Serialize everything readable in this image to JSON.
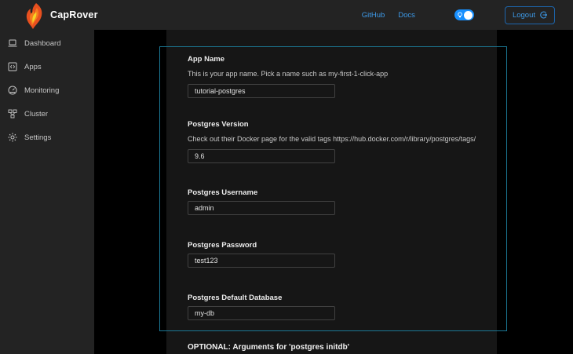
{
  "header": {
    "app_title": "CapRover",
    "logo_icon": "flame-logo-icon",
    "links": [
      {
        "label": "GitHub"
      },
      {
        "label": "Docs"
      }
    ],
    "theme_toggle": {
      "icon": "bulb-icon",
      "state": "on"
    },
    "logout_label": "Logout",
    "logout_icon": "logout-icon",
    "colors": {
      "accent": "#1890ff",
      "link": "#3d9ae8",
      "bar_bg": "#232323"
    }
  },
  "sidebar": {
    "items": [
      {
        "label": "Dashboard",
        "icon": "laptop-icon"
      },
      {
        "label": "Apps",
        "icon": "code-icon"
      },
      {
        "label": "Monitoring",
        "icon": "dashboard-gauge-icon"
      },
      {
        "label": "Cluster",
        "icon": "cluster-icon"
      },
      {
        "label": "Settings",
        "icon": "gear-icon"
      }
    ]
  },
  "form": {
    "fields": [
      {
        "label": "App Name",
        "description": "This is your app name. Pick a name such as my-first-1-click-app",
        "value": "tutorial-postgres"
      },
      {
        "label": "Postgres Version",
        "description": "Check out their Docker page for the valid tags https://hub.docker.com/r/library/postgres/tags/",
        "value": "9.6"
      },
      {
        "label": "Postgres Username",
        "description": "",
        "value": "admin"
      },
      {
        "label": "Postgres Password",
        "description": "",
        "value": "test123"
      },
      {
        "label": "Postgres Default Database",
        "description": "",
        "value": "my-db"
      }
    ],
    "next_section_label": "OPTIONAL: Arguments for 'postgres initdb'"
  },
  "annotation": {
    "highlight_color": "#1b7895",
    "card_bg": "#161616",
    "page_bg": "#000000"
  }
}
